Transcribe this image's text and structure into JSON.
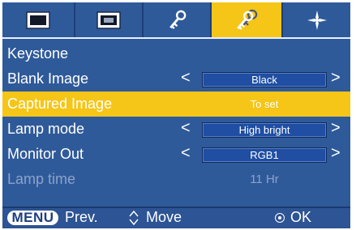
{
  "tabs": [
    {
      "icon": "picture-icon",
      "active": false
    },
    {
      "icon": "screen-icon",
      "active": false
    },
    {
      "icon": "key-icon",
      "active": false
    },
    {
      "icon": "double-key-icon",
      "active": true
    },
    {
      "icon": "setup-icon",
      "active": false
    }
  ],
  "menu": {
    "items": [
      {
        "label": "Keystone"
      },
      {
        "label": "Blank Image",
        "value": "Black"
      },
      {
        "label": "Captured Image",
        "value": "To set"
      },
      {
        "label": "Lamp mode",
        "value": "High bright"
      },
      {
        "label": "Monitor Out",
        "value": "RGB1"
      },
      {
        "label": "Lamp time",
        "value": "11 Hr"
      }
    ],
    "arrows": {
      "left": "<",
      "right": ">"
    }
  },
  "footer": {
    "menu_label": "MENU",
    "prev_label": "Prev.",
    "move_label": "Move",
    "ok_label": "OK"
  },
  "colors": {
    "background": "#2f5a9a",
    "highlight": "#f5c518",
    "value_box": "#1f4ea3",
    "disabled_text": "#8aa3c8"
  }
}
